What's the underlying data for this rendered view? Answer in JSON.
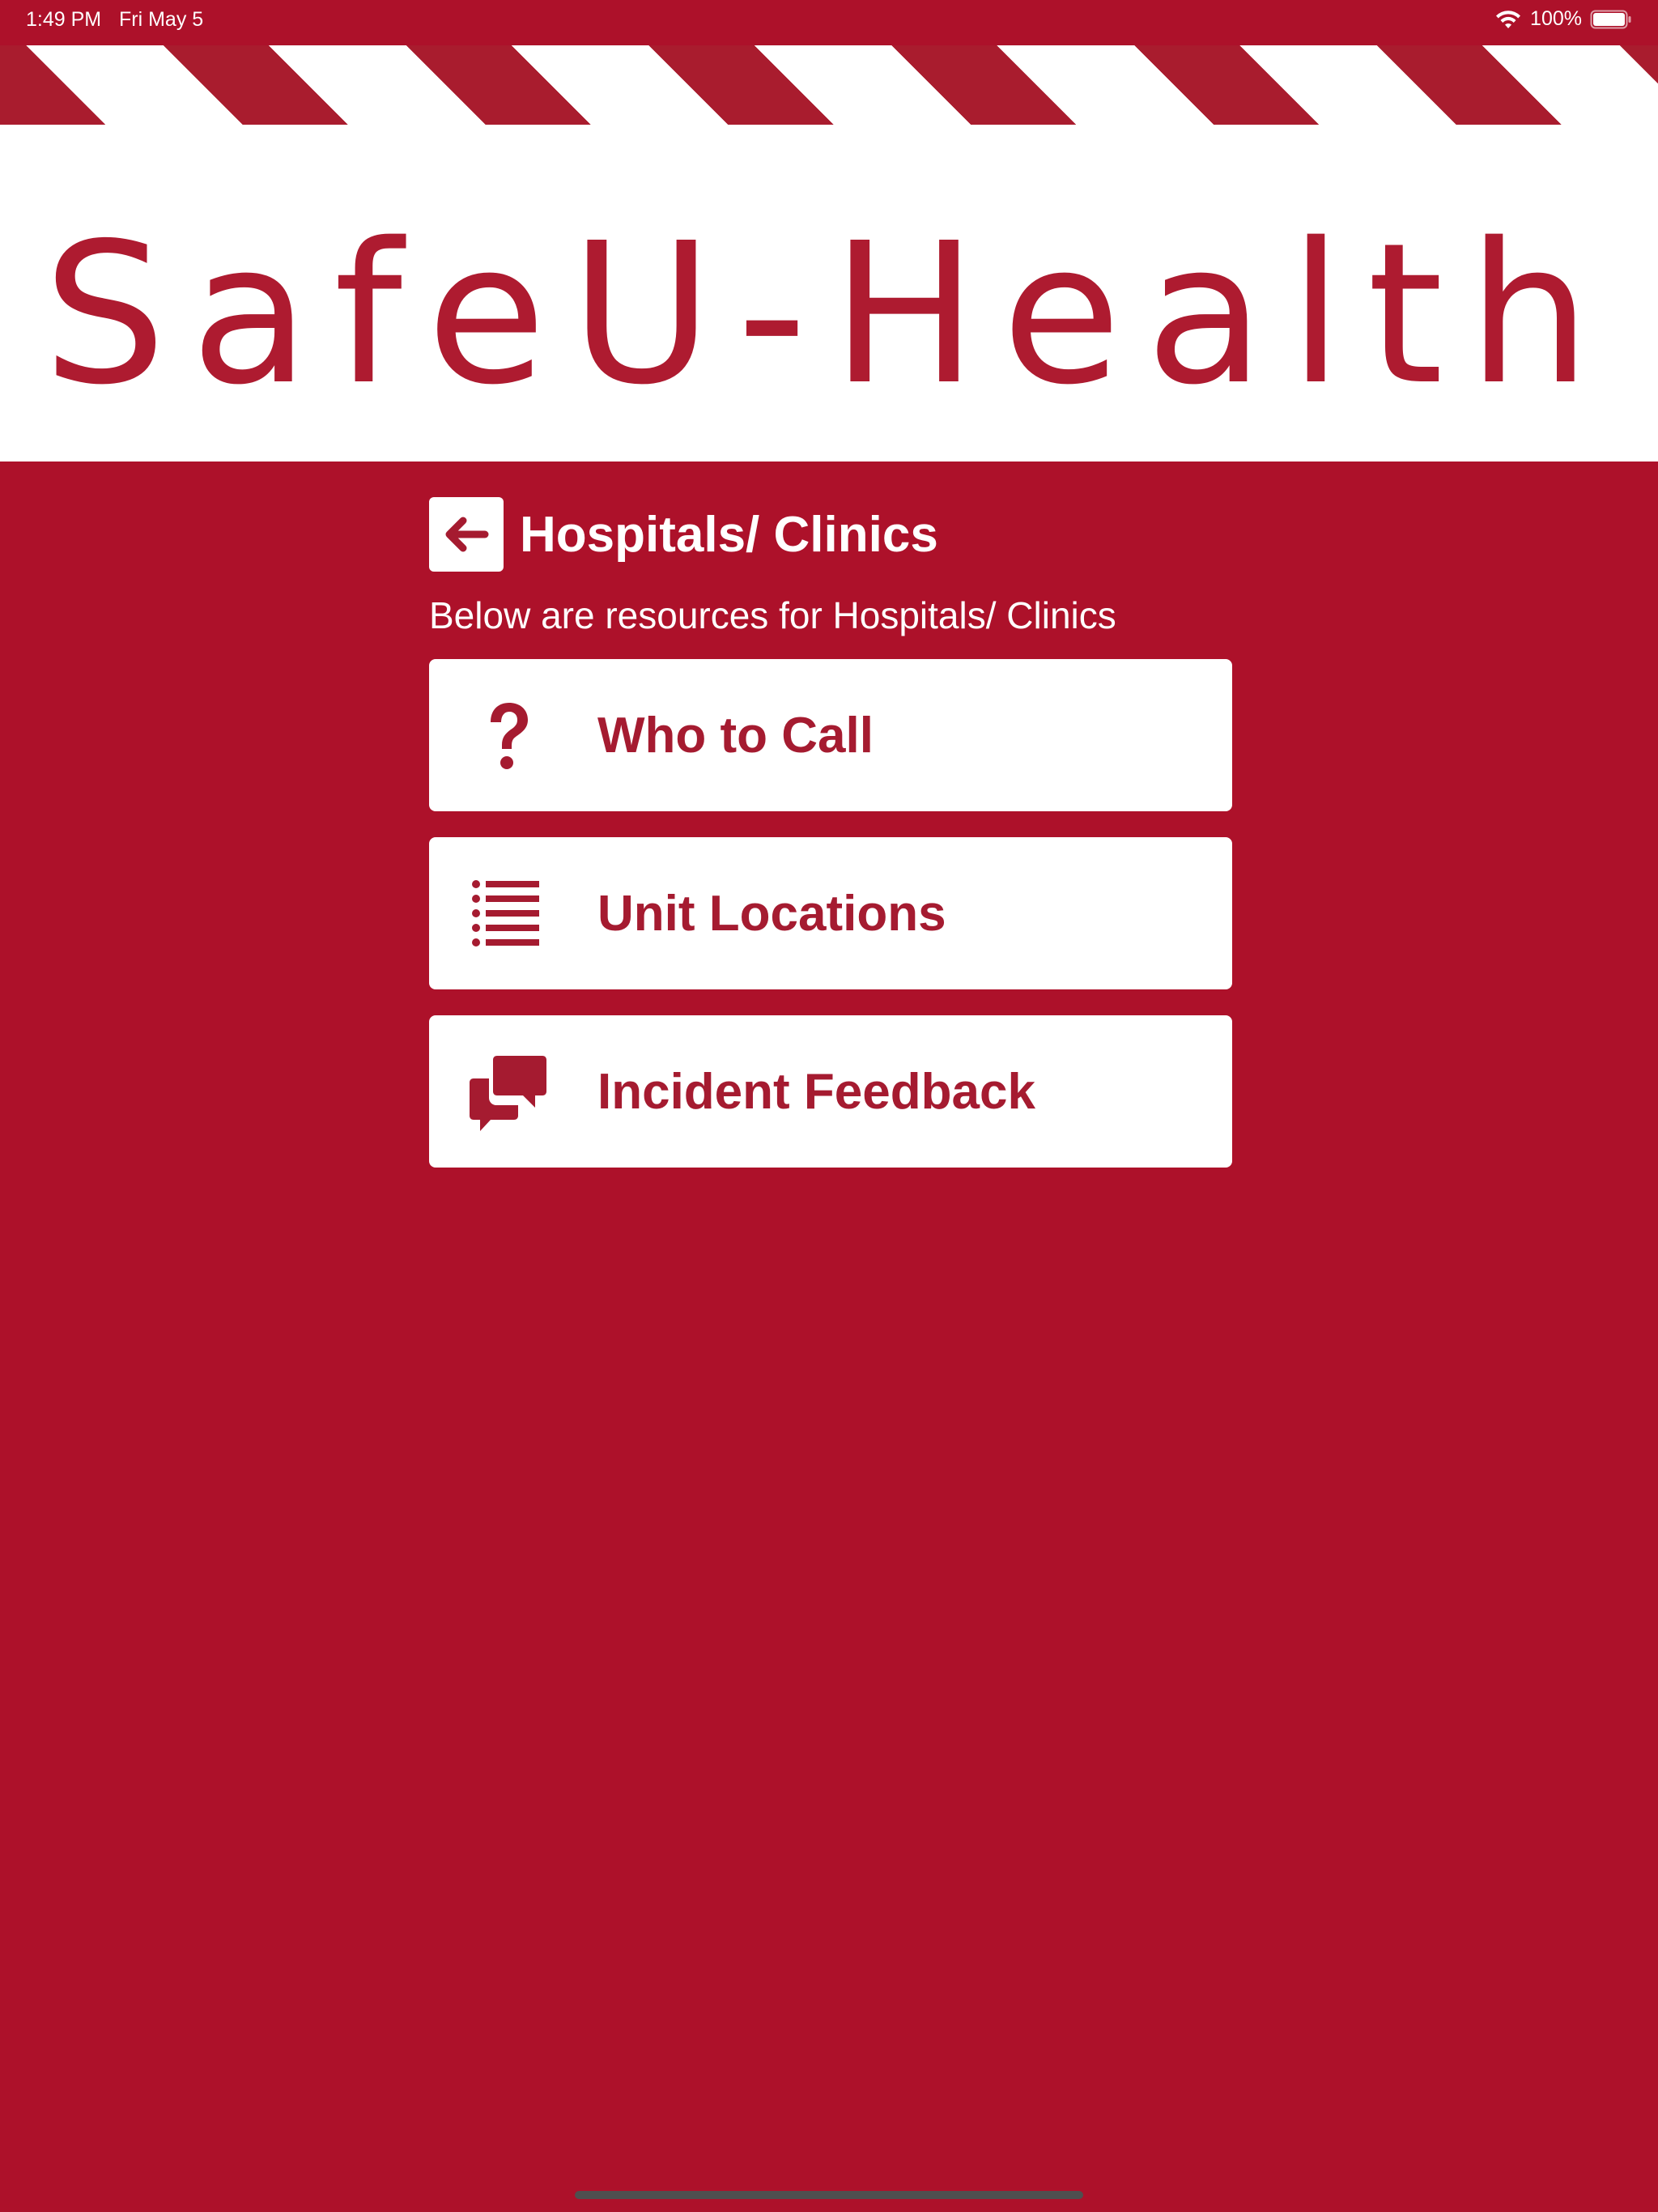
{
  "status_bar": {
    "time": "1:49 PM",
    "date": "Fri May 5",
    "battery_percent": "100%",
    "wifi_icon": "wifi-icon",
    "battery_icon": "battery-full-icon"
  },
  "header": {
    "logo_text": "SafeU-Health"
  },
  "page": {
    "title": "Hospitals/ Clinics",
    "subtitle": "Below are resources for Hospitals/ Clinics",
    "back_icon": "arrow-left-icon"
  },
  "resources": [
    {
      "label": "Who to Call",
      "icon": "question-mark-icon"
    },
    {
      "label": "Unit Locations",
      "icon": "list-icon"
    },
    {
      "label": "Incident Feedback",
      "icon": "comments-icon"
    }
  ],
  "colors": {
    "background": "#ad112a",
    "accent": "#a51b30",
    "surface": "#ffffff"
  }
}
